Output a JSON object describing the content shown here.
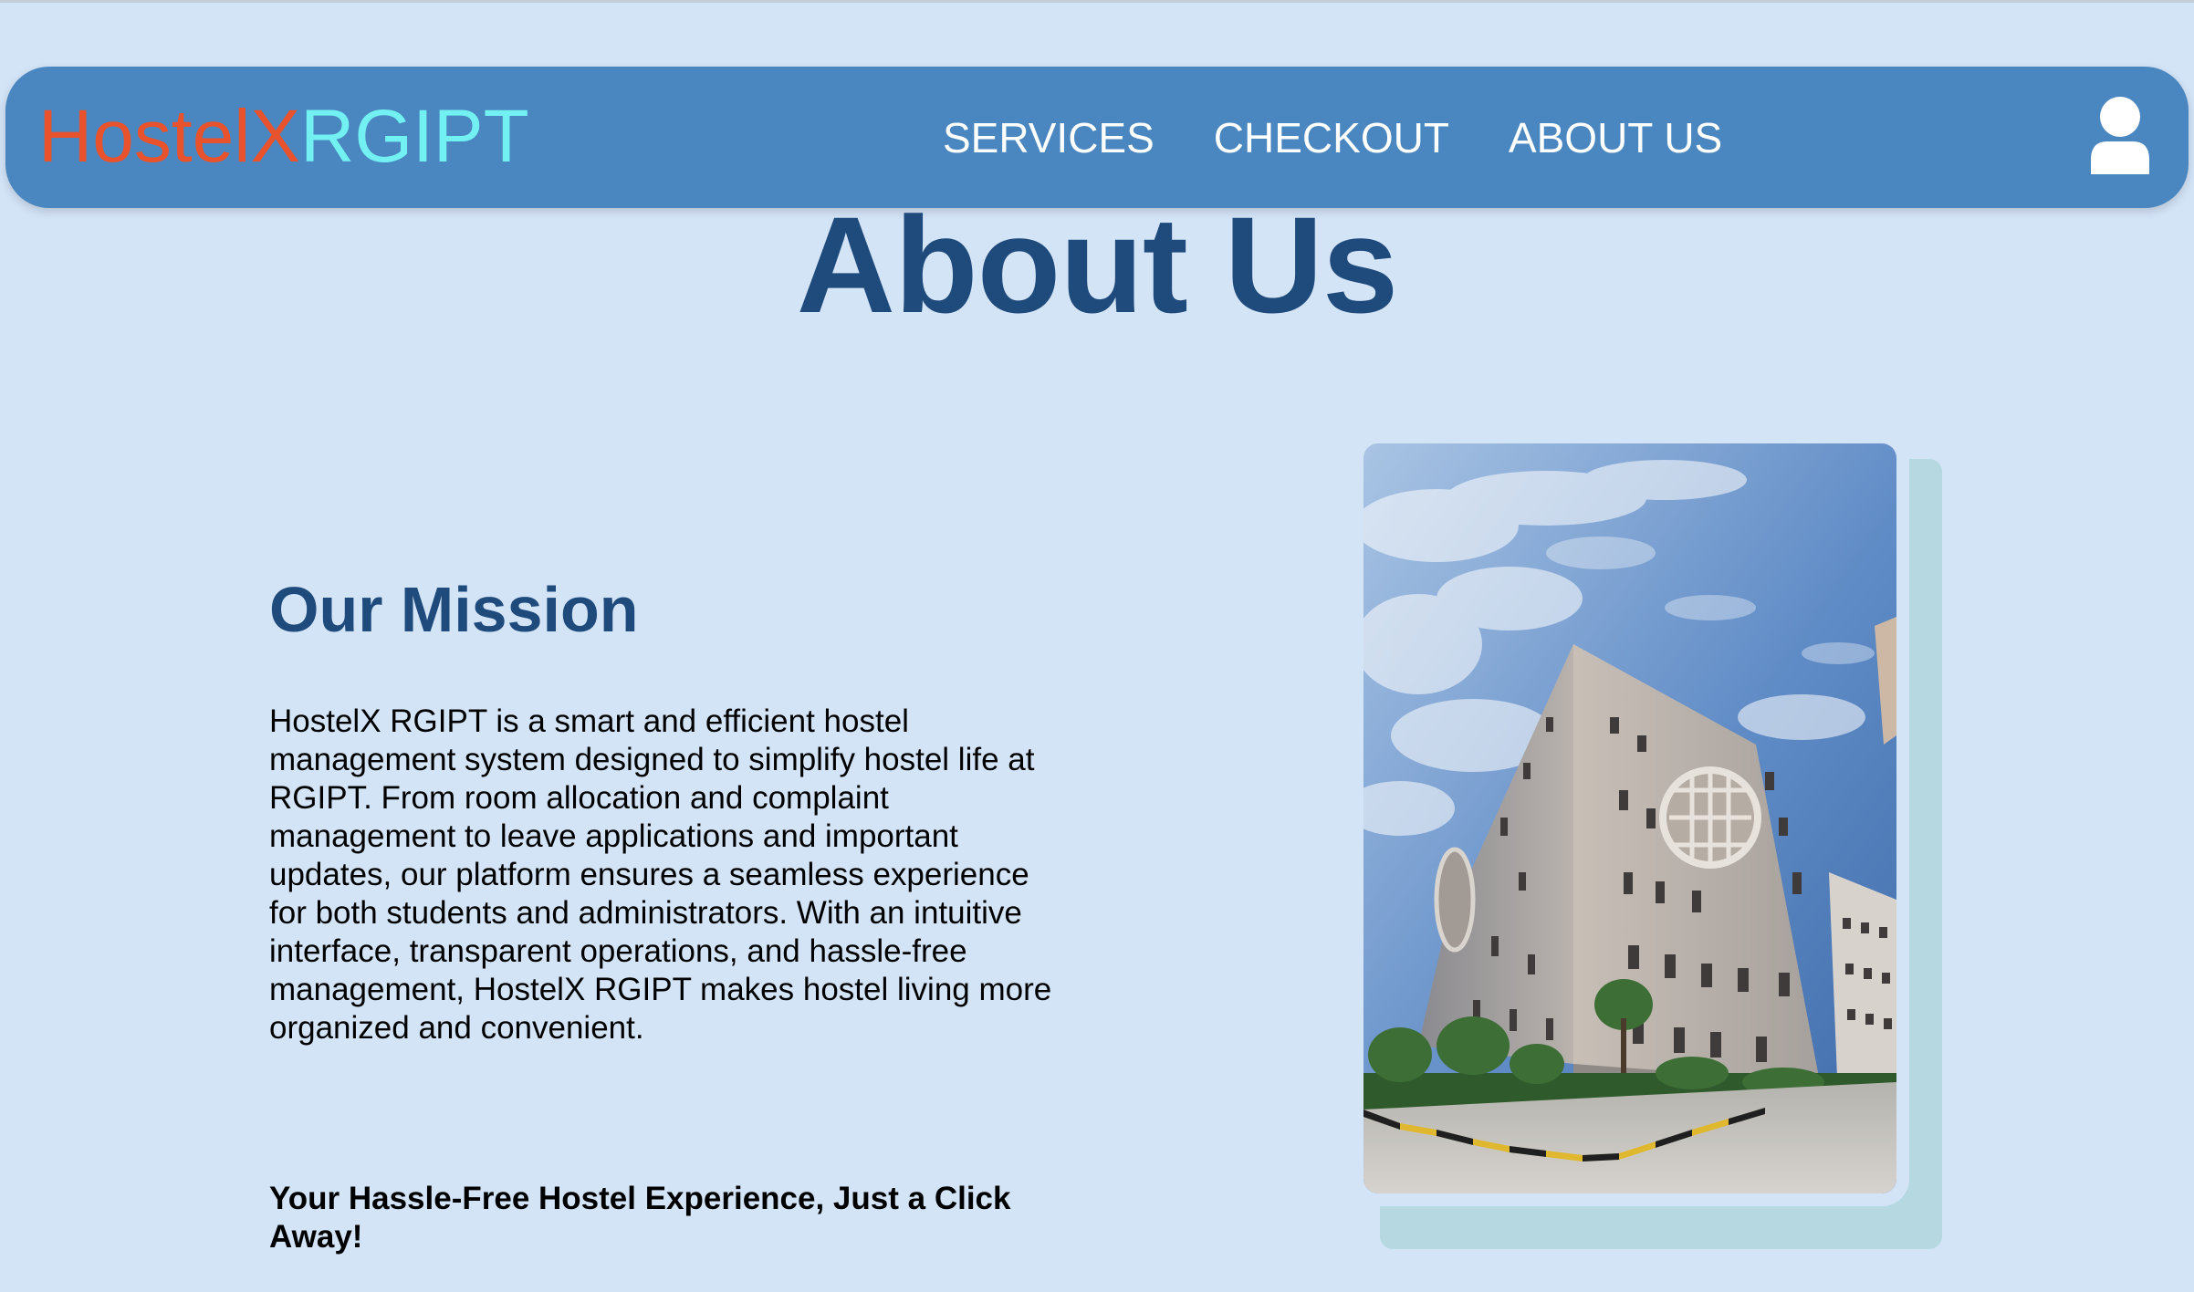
{
  "header": {
    "logo_part1": "HostelX",
    "logo_part2": "RGIPT",
    "nav": [
      {
        "label": "SERVICES"
      },
      {
        "label": "CHECKOUT"
      },
      {
        "label": "ABOUT US"
      }
    ],
    "user_icon": "user-icon"
  },
  "page": {
    "title": "About Us"
  },
  "mission": {
    "heading": "Our Mission",
    "body": "HostelX RGIPT is a smart and efficient hostel management system designed to simplify hostel life at RGIPT. From room allocation and complaint management to leave applications and important updates, our platform ensures a seamless experience for both students and administrators. With an intuitive interface, transparent operations, and hassle-free management, HostelX RGIPT makes hostel living more organized and convenient.",
    "tagline": "Your Hassle-Free Hostel Experience, Just a Click Away!"
  },
  "colors": {
    "background": "#d3e4f7",
    "navbar": "#4a87c0",
    "logo_accent_1": "#e8532e",
    "logo_accent_2": "#73f1f2",
    "heading": "#1f4a7c",
    "image_shadow": "#b6d9e1"
  }
}
